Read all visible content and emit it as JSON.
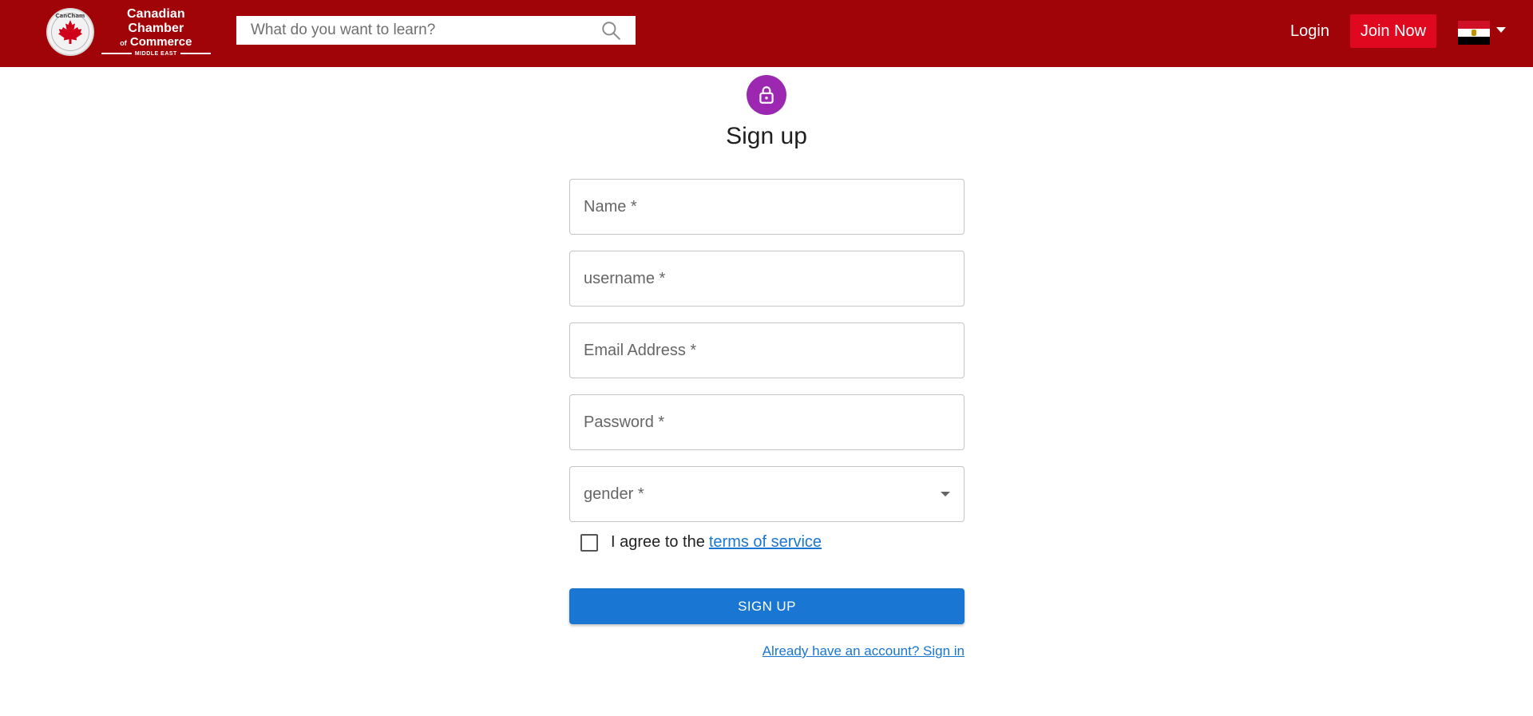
{
  "header": {
    "logo": {
      "seal_text": "CanCham",
      "line1": "Canadian Chamber",
      "line2_prefix": "of",
      "line2": "Commerce",
      "line3": "MIDDLE EAST"
    },
    "search": {
      "placeholder": "What do you want to learn?",
      "icon": "search-icon"
    },
    "login_label": "Login",
    "join_label": "Join Now",
    "language": {
      "flag": "egypt-flag-icon",
      "dropdown_icon": "caret-down-icon"
    },
    "colors": {
      "bar": "#a00308",
      "join": "#e0081f"
    }
  },
  "form": {
    "avatar_icon": "lock-icon",
    "avatar_color": "#9c27b0",
    "title": "Sign up",
    "fields": {
      "name": "Name *",
      "username": "username *",
      "email": "Email Address *",
      "password": "Password *",
      "gender": "gender *"
    },
    "agree": {
      "text": "I agree to the",
      "link": "terms of service"
    },
    "submit_label": "SIGN UP",
    "submit_color": "#1976d2",
    "signin_link": "Already have an account? Sign in"
  }
}
